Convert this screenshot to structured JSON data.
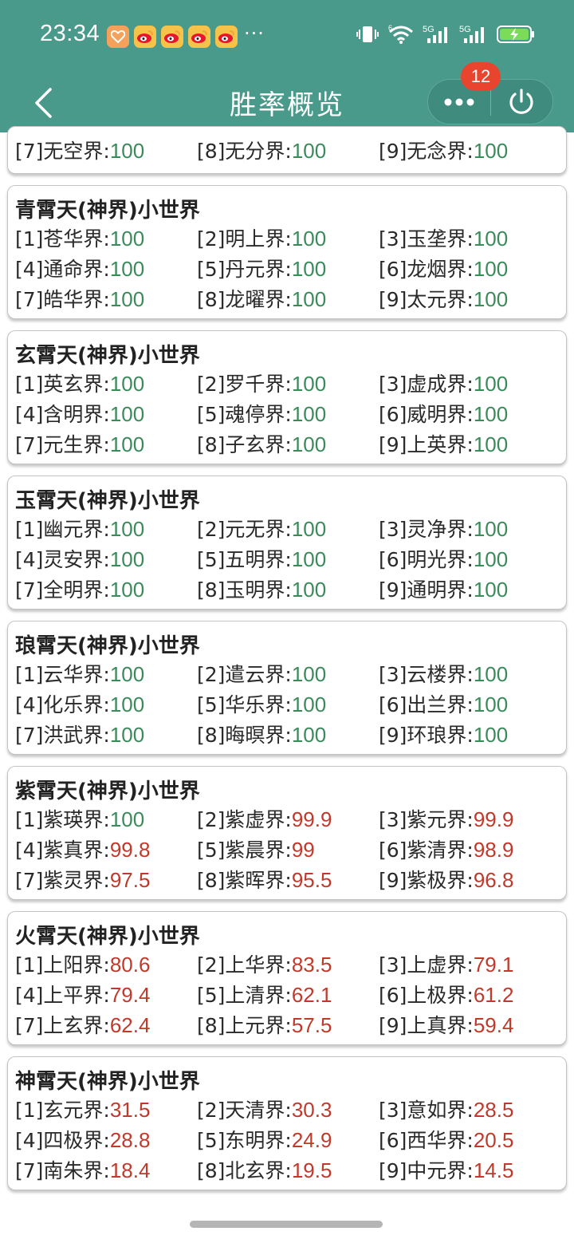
{
  "status_bar": {
    "time": "23:34",
    "overflow": "···",
    "network_5g_a": "5G",
    "network_5g_b": "5G",
    "wifi_tag": "6"
  },
  "header": {
    "title": "胜率概览",
    "badge_count": "12"
  },
  "colors": {
    "header_bg": "#4a9a8c",
    "good": "#3a8a5a",
    "bad": "#c0392b",
    "badge": "#e8442e"
  },
  "groups": [
    {
      "title": "",
      "partial": true,
      "rows": [
        [
          {
            "label": "[7]无空界:",
            "value": "100",
            "status": "good"
          },
          {
            "label": "[8]无分界:",
            "value": "100",
            "status": "good"
          },
          {
            "label": "[9]无念界:",
            "value": "100",
            "status": "good"
          }
        ]
      ]
    },
    {
      "title": "青霄天(神界)小世界",
      "rows": [
        [
          {
            "label": "[1]苍华界:",
            "value": "100",
            "status": "good"
          },
          {
            "label": "[2]明上界:",
            "value": "100",
            "status": "good"
          },
          {
            "label": "[3]玉垄界:",
            "value": "100",
            "status": "good"
          }
        ],
        [
          {
            "label": "[4]通命界:",
            "value": "100",
            "status": "good"
          },
          {
            "label": "[5]丹元界:",
            "value": "100",
            "status": "good"
          },
          {
            "label": "[6]龙烟界:",
            "value": "100",
            "status": "good"
          }
        ],
        [
          {
            "label": "[7]皓华界:",
            "value": "100",
            "status": "good"
          },
          {
            "label": "[8]龙曜界:",
            "value": "100",
            "status": "good"
          },
          {
            "label": "[9]太元界:",
            "value": "100",
            "status": "good"
          }
        ]
      ]
    },
    {
      "title": "玄霄天(神界)小世界",
      "rows": [
        [
          {
            "label": "[1]英玄界:",
            "value": "100",
            "status": "good"
          },
          {
            "label": "[2]罗千界:",
            "value": "100",
            "status": "good"
          },
          {
            "label": "[3]虚成界:",
            "value": "100",
            "status": "good"
          }
        ],
        [
          {
            "label": "[4]含明界:",
            "value": "100",
            "status": "good"
          },
          {
            "label": "[5]魂停界:",
            "value": "100",
            "status": "good"
          },
          {
            "label": "[6]威明界:",
            "value": "100",
            "status": "good"
          }
        ],
        [
          {
            "label": "[7]元生界:",
            "value": "100",
            "status": "good"
          },
          {
            "label": "[8]子玄界:",
            "value": "100",
            "status": "good"
          },
          {
            "label": "[9]上英界:",
            "value": "100",
            "status": "good"
          }
        ]
      ]
    },
    {
      "title": "玉霄天(神界)小世界",
      "rows": [
        [
          {
            "label": "[1]幽元界:",
            "value": "100",
            "status": "good"
          },
          {
            "label": "[2]元无界:",
            "value": "100",
            "status": "good"
          },
          {
            "label": "[3]灵净界:",
            "value": "100",
            "status": "good"
          }
        ],
        [
          {
            "label": "[4]灵安界:",
            "value": "100",
            "status": "good"
          },
          {
            "label": "[5]五明界:",
            "value": "100",
            "status": "good"
          },
          {
            "label": "[6]明光界:",
            "value": "100",
            "status": "good"
          }
        ],
        [
          {
            "label": "[7]全明界:",
            "value": "100",
            "status": "good"
          },
          {
            "label": "[8]玉明界:",
            "value": "100",
            "status": "good"
          },
          {
            "label": "[9]通明界:",
            "value": "100",
            "status": "good"
          }
        ]
      ]
    },
    {
      "title": "琅霄天(神界)小世界",
      "rows": [
        [
          {
            "label": "[1]云华界:",
            "value": "100",
            "status": "good"
          },
          {
            "label": "[2]遣云界:",
            "value": "100",
            "status": "good"
          },
          {
            "label": "[3]云楼界:",
            "value": "100",
            "status": "good"
          }
        ],
        [
          {
            "label": "[4]化乐界:",
            "value": "100",
            "status": "good"
          },
          {
            "label": "[5]华乐界:",
            "value": "100",
            "status": "good"
          },
          {
            "label": "[6]出兰界:",
            "value": "100",
            "status": "good"
          }
        ],
        [
          {
            "label": "[7]洪武界:",
            "value": "100",
            "status": "good"
          },
          {
            "label": "[8]晦暝界:",
            "value": "100",
            "status": "good"
          },
          {
            "label": "[9]环琅界:",
            "value": "100",
            "status": "good"
          }
        ]
      ]
    },
    {
      "title": "紫霄天(神界)小世界",
      "rows": [
        [
          {
            "label": "[1]紫瑛界:",
            "value": "100",
            "status": "good"
          },
          {
            "label": "[2]紫虚界:",
            "value": "99.9",
            "status": "bad"
          },
          {
            "label": "[3]紫元界:",
            "value": "99.9",
            "status": "bad"
          }
        ],
        [
          {
            "label": "[4]紫真界:",
            "value": "99.8",
            "status": "bad"
          },
          {
            "label": "[5]紫晨界:",
            "value": "99",
            "status": "bad"
          },
          {
            "label": "[6]紫清界:",
            "value": "98.9",
            "status": "bad"
          }
        ],
        [
          {
            "label": "[7]紫灵界:",
            "value": "97.5",
            "status": "bad"
          },
          {
            "label": "[8]紫晖界:",
            "value": "95.5",
            "status": "bad"
          },
          {
            "label": "[9]紫极界:",
            "value": "96.8",
            "status": "bad"
          }
        ]
      ]
    },
    {
      "title": "火霄天(神界)小世界",
      "rows": [
        [
          {
            "label": "[1]上阳界:",
            "value": "80.6",
            "status": "bad"
          },
          {
            "label": "[2]上华界:",
            "value": "83.5",
            "status": "bad"
          },
          {
            "label": "[3]上虚界:",
            "value": "79.1",
            "status": "bad"
          }
        ],
        [
          {
            "label": "[4]上平界:",
            "value": "79.4",
            "status": "bad"
          },
          {
            "label": "[5]上清界:",
            "value": "62.1",
            "status": "bad"
          },
          {
            "label": "[6]上极界:",
            "value": "61.2",
            "status": "bad"
          }
        ],
        [
          {
            "label": "[7]上玄界:",
            "value": "62.4",
            "status": "bad"
          },
          {
            "label": "[8]上元界:",
            "value": "57.5",
            "status": "bad"
          },
          {
            "label": "[9]上真界:",
            "value": "59.4",
            "status": "bad"
          }
        ]
      ]
    },
    {
      "title": "神霄天(神界)小世界",
      "rows": [
        [
          {
            "label": "[1]玄元界:",
            "value": "31.5",
            "status": "bad"
          },
          {
            "label": "[2]天清界:",
            "value": "30.3",
            "status": "bad"
          },
          {
            "label": "[3]意如界:",
            "value": "28.5",
            "status": "bad"
          }
        ],
        [
          {
            "label": "[4]四极界:",
            "value": "28.8",
            "status": "bad"
          },
          {
            "label": "[5]东明界:",
            "value": "24.9",
            "status": "bad"
          },
          {
            "label": "[6]西华界:",
            "value": "20.5",
            "status": "bad"
          }
        ],
        [
          {
            "label": "[7]南朱界:",
            "value": "18.4",
            "status": "bad"
          },
          {
            "label": "[8]北玄界:",
            "value": "19.5",
            "status": "bad"
          },
          {
            "label": "[9]中元界:",
            "value": "14.5",
            "status": "bad"
          }
        ]
      ]
    }
  ]
}
